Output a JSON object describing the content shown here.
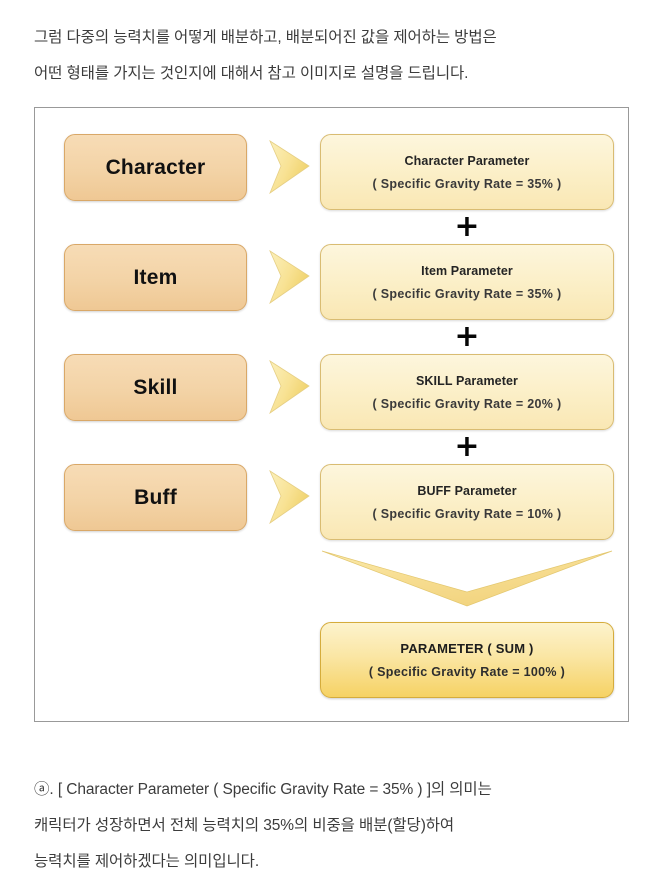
{
  "intro_paragraph": {
    "line1": "그럼 다중의 능력치를 어떻게 배분하고, 배분되어진 값을 제어하는 방법은",
    "line2": "어떤 형태를 가지는 것인지에 대해서 참고 이미지로 설명을 드립니다."
  },
  "diagram": {
    "rows": [
      {
        "source_label": "Character",
        "param_title": "Character Parameter",
        "param_rate": "( Specific Gravity Rate = 35% )",
        "operator": "+"
      },
      {
        "source_label": "Item",
        "param_title": "Item Parameter",
        "param_rate": "( Specific Gravity Rate = 35% )",
        "operator": "+"
      },
      {
        "source_label": "Skill",
        "param_title": "SKILL Parameter",
        "param_rate": "( Specific Gravity Rate = 20% )",
        "operator": "+"
      },
      {
        "source_label": "Buff",
        "param_title": "BUFF Parameter",
        "param_rate": "( Specific Gravity Rate = 10% )",
        "operator": ""
      }
    ],
    "sum": {
      "title": "PARAMETER ( SUM )",
      "rate": "( Specific Gravity Rate = 100% )"
    },
    "colors": {
      "source_box_fill": "#f3d3a6",
      "source_box_border": "#d9a868",
      "param_box_fill": "#fbeec4",
      "param_box_border": "#d9bc72",
      "sum_box_fill": "#f6d264",
      "sum_box_border": "#d5ac3c",
      "arrow_fill": "#f6e08a",
      "frame_border": "#999999"
    }
  },
  "outro_paragraph": {
    "line1": "ⓐ. [ Character Parameter ( Specific Gravity Rate = 35% ) ]의 의미는",
    "line2": "캐릭터가 성장하면서 전체 능력치의 35%의 비중을 배분(할당)하여",
    "line3": "능력치를 제어하겠다는 의미입니다."
  }
}
